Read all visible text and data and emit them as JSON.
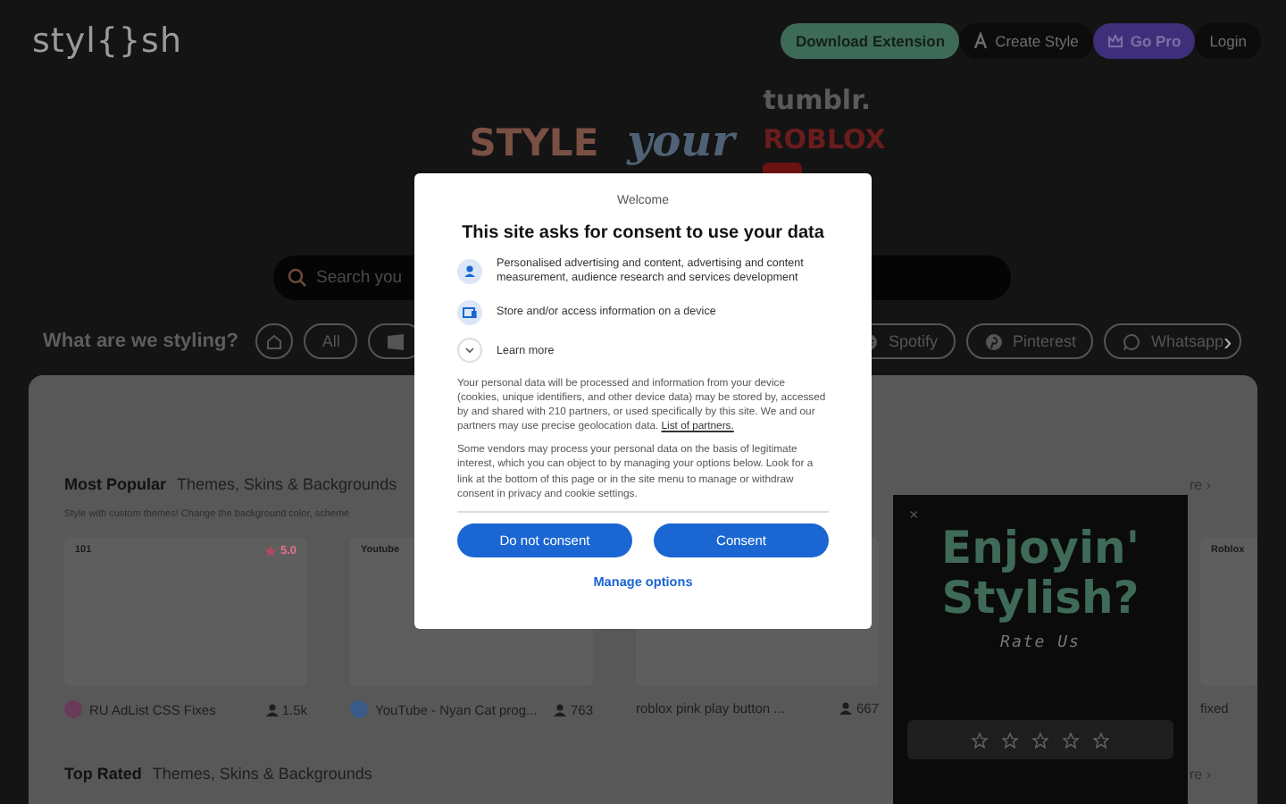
{
  "header": {
    "logo": "styl{}sh",
    "buttons": [
      {
        "label": "Download Extension",
        "kind": "download"
      },
      {
        "label": "Create Style",
        "kind": "create"
      },
      {
        "label": "Go Pro",
        "kind": "pro"
      },
      {
        "label": "Login",
        "kind": "login"
      }
    ]
  },
  "hero": {
    "word_1": "STYLE",
    "word_2": "your",
    "brands": [
      "tumblr.",
      "ROBLOX"
    ]
  },
  "search": {
    "placeholder": "Search you"
  },
  "categories": {
    "title": "What are we styling?",
    "items": [
      {
        "kind": "home"
      },
      {
        "label": "All",
        "kind": "text"
      },
      {
        "kind": "windows"
      },
      {
        "label": "Spotify",
        "kind": "spotify"
      },
      {
        "label": "Pinterest",
        "kind": "pinterest"
      },
      {
        "label": "Whatsapp",
        "kind": "whatsapp"
      }
    ],
    "next": "›"
  },
  "sections": [
    {
      "title": "Most Popular",
      "subtitle": "Themes, Skins & Backgrounds",
      "description": "Style with custom themes! Change the background color, scheme",
      "more": "re ›",
      "cards": [
        {
          "tag": "101",
          "rating": "5.0",
          "name": "RU AdList CSS Fixes",
          "users": "1.5k",
          "color": "#6a3a5a"
        },
        {
          "tag": "Youtube",
          "name": "YouTube - Nyan Cat prog...",
          "users": "763",
          "color": "#3a5a8a"
        },
        {
          "name": "roblox pink play button ...",
          "users": "667"
        },
        {
          "tag": "Roblox",
          "name": "fixed"
        }
      ]
    },
    {
      "title": "Top Rated",
      "subtitle": "Themes, Skins & Backgrounds",
      "more": "re ›"
    }
  ],
  "rate_popup": {
    "close": "×",
    "title_1": "Enjoyin'",
    "title_2": "Stylish?",
    "subtitle": "Rate Us",
    "stars": 0
  },
  "consent": {
    "welcome": "Welcome",
    "title": "This site asks for consent to use your data",
    "purposes": [
      {
        "text": "Personalised advertising and content, advertising and content measurement, audience research and services development",
        "kind": "person"
      },
      {
        "text": "Store and/or access information on a device",
        "kind": "device"
      }
    ],
    "learn_more": "Learn more",
    "paragraphs": [
      {
        "text": "Your personal data will be processed and information from your device (cookies, unique identifiers, and other device data) may be stored by, accessed by and shared with 210 partners, or used specifically by this site. We and our partners may use precise geolocation data.",
        "link": "List of partners."
      },
      {
        "text": "Some vendors may process your personal data on the basis of legitimate interest, which you can object to by managing your options below. Look for a link at the bottom of this page or in the site menu to manage or withdraw consent in privacy and cookie settings."
      }
    ],
    "buttons": [
      "Do not consent",
      "Consent"
    ],
    "manage": "Manage options"
  }
}
